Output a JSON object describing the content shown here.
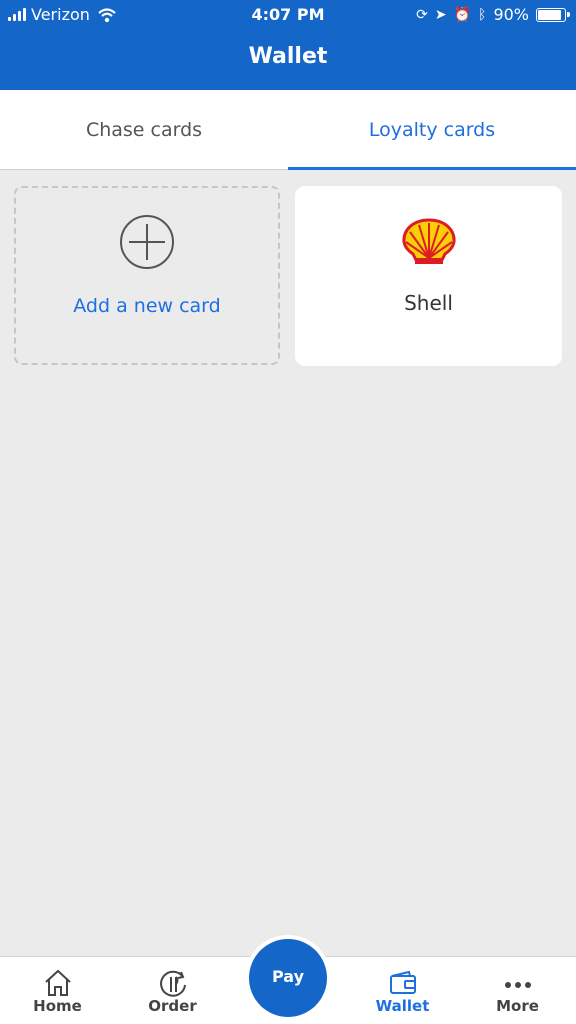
{
  "status_bar": {
    "carrier": "Verizon",
    "time": "4:07 PM",
    "battery_percent": "90%",
    "battery_level": 0.9
  },
  "header": {
    "title": "Wallet"
  },
  "tabs": [
    {
      "label": "Chase cards",
      "active": false
    },
    {
      "label": "Loyalty cards",
      "active": true
    }
  ],
  "cards": {
    "add_label": "Add a new card",
    "items": [
      {
        "label": "Shell",
        "icon": "shell-logo-icon"
      }
    ]
  },
  "bottom_nav": {
    "items": [
      {
        "label": "Home",
        "icon": "home-icon"
      },
      {
        "label": "Order",
        "icon": "order-icon"
      },
      {
        "label": "Wallet",
        "icon": "wallet-icon",
        "active": true
      },
      {
        "label": "More",
        "icon": "more-icon"
      }
    ],
    "pay_label": "Pay"
  },
  "colors": {
    "brand_blue": "#1466c9",
    "accent_blue": "#1f6fe0",
    "shell_red": "#dd1d21",
    "shell_yellow": "#fbce07"
  }
}
